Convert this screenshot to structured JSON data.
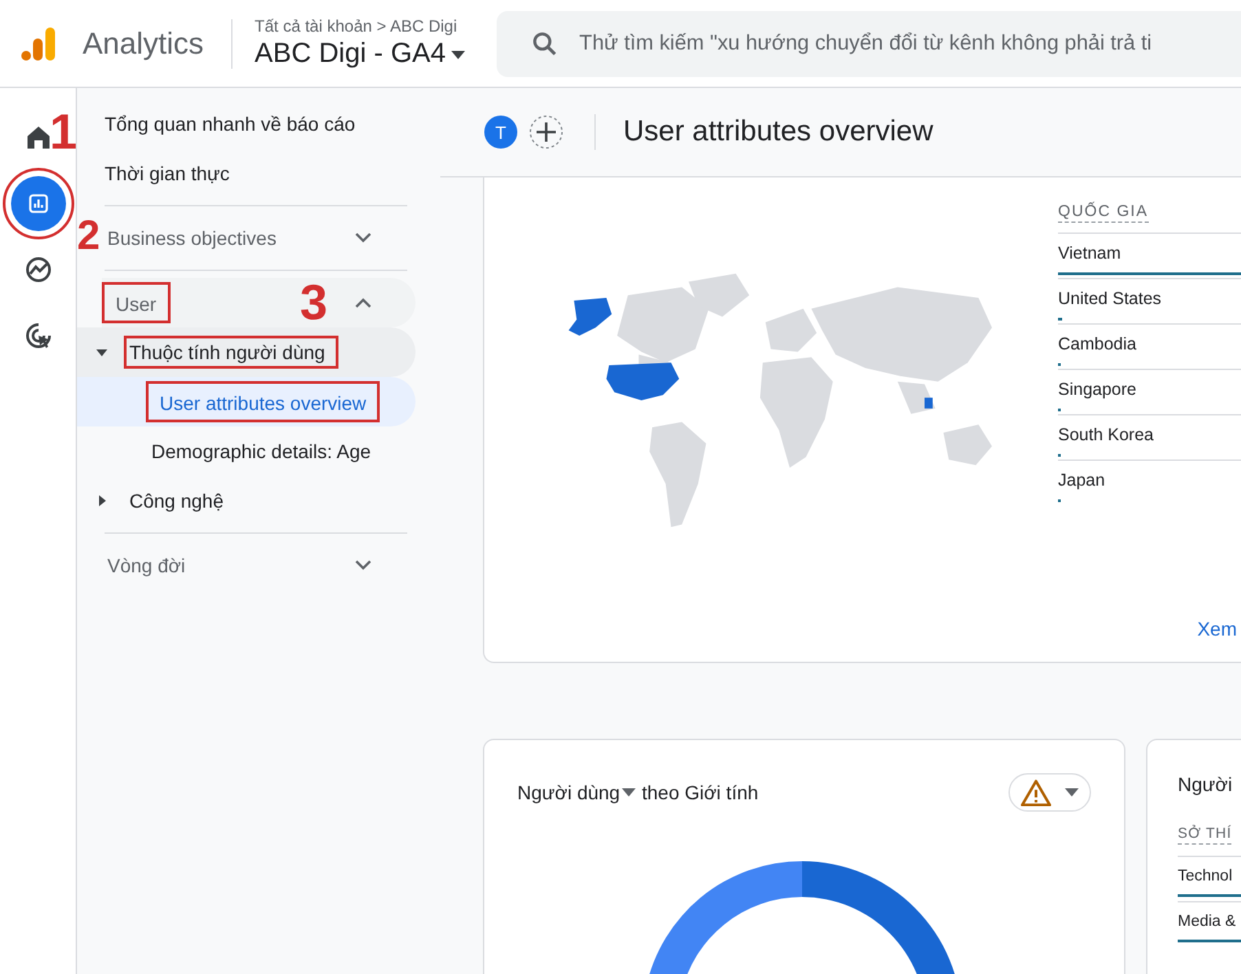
{
  "app": {
    "name": "Analytics",
    "breadcrumb": "Tất cả tài khoản > ABC Digi",
    "property": "ABC Digi - GA4"
  },
  "search": {
    "placeholder": "Thử tìm kiếm \"xu hướng chuyển đổi từ kênh không phải trả ti"
  },
  "rail": [
    {
      "kind": "home",
      "selected": false,
      "highlighted": false
    },
    {
      "kind": "reports",
      "selected": true,
      "highlighted": true
    },
    {
      "kind": "explore",
      "selected": false,
      "highlighted": false
    },
    {
      "kind": "advertising",
      "selected": false,
      "highlighted": false
    }
  ],
  "nav": [
    {
      "kind": "link",
      "label": "Tổng quan nhanh về báo cáo"
    },
    {
      "kind": "link",
      "label": "Thời gian thực"
    },
    {
      "kind": "section",
      "label": "Business objectives",
      "expanded": false,
      "highlighted": false
    },
    {
      "kind": "section",
      "label": "User",
      "expanded": true,
      "highlighted": true,
      "children": [
        {
          "kind": "group",
          "label": "Thuộc tính người dùng",
          "expanded": true,
          "highlighted": true,
          "children": [
            {
              "label": "User attributes overview",
              "selected": true,
              "highlighted": true
            },
            {
              "label": "Demographic details: Age",
              "selected": false,
              "highlighted": false
            }
          ]
        },
        {
          "kind": "group",
          "label": "Công nghệ",
          "expanded": false,
          "highlighted": false
        }
      ]
    },
    {
      "kind": "section",
      "label": "Vòng đời",
      "expanded": false,
      "highlighted": false
    }
  ],
  "markers": [
    "1",
    "2",
    "3"
  ],
  "header": {
    "avatar": "T",
    "title": "User attributes overview"
  },
  "country_card": {
    "heading": "QUỐC GIA",
    "link": "Xem",
    "rows": [
      {
        "name": "Vietnam",
        "level": 1
      },
      {
        "name": "United States",
        "level": 0.02
      },
      {
        "name": "Cambodia",
        "level": 0.01
      },
      {
        "name": "Singapore",
        "level": 0.01
      },
      {
        "name": "South Korea",
        "level": 0.01
      },
      {
        "name": "Japan",
        "level": 0.01
      }
    ]
  },
  "gender_card": {
    "title_metric": "Người dùng",
    "title_rest": "theo Giới tính"
  },
  "interest_card": {
    "title": "Người",
    "heading": "SỞ THÍ",
    "rows": [
      "Technol",
      "Media &"
    ]
  }
}
